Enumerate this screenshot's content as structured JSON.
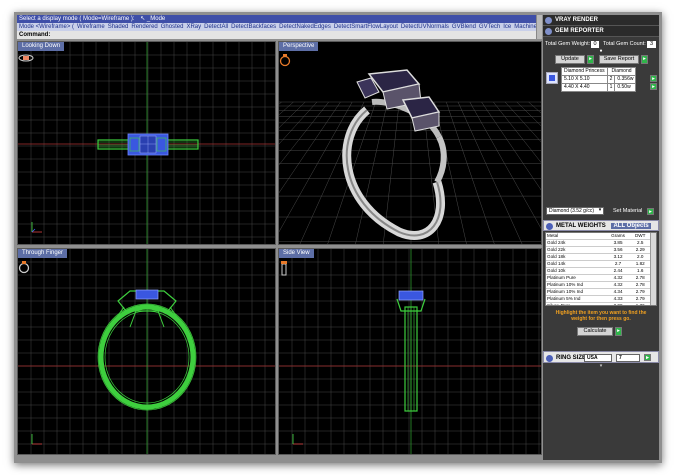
{
  "command_area": {
    "prompt": "Select a display mode ( Mode=Wireframe ):",
    "prompt_tail": "_Mode",
    "modes": [
      "Mode <Wireframe> (",
      "Wireframe",
      "Shaded",
      "Rendered",
      "Ghosted",
      "XRay",
      "DetectAll",
      "DetectBackfaces",
      "DetectNakedEdges",
      "DetectSmartFlowLayout",
      "DetectUVNormals",
      "GVBlend",
      "GVTech",
      "Ice",
      "Machine",
      "Plastic",
      "Presentation"
    ],
    "command_label": "Command:"
  },
  "viewports": {
    "top_left": {
      "title": "Looking Down"
    },
    "top_right": {
      "title": "Perspective"
    },
    "bottom_left": {
      "title": "Through Finger"
    },
    "bottom_right": {
      "title": "Side View"
    }
  },
  "panel": {
    "vray_header": "VRAY RENDER",
    "gem_header": "GEM REPORTER",
    "total_gem_weight_label": "Total Gem Weight:",
    "total_gem_weight_value": "0",
    "total_gem_count_label": "Total Gem Count:",
    "total_gem_count_value": "3",
    "update_label": "Update",
    "save_report_label": "Save Report",
    "gem_table": {
      "headers": [
        "Diamond Princess",
        "Diamond"
      ],
      "rows": [
        {
          "size": "5.10 X 5.10",
          "count": "2",
          "weight": "0.356w"
        },
        {
          "size": "4.40 X 4.40",
          "count": "1",
          "weight": "0.50w"
        }
      ]
    },
    "material_select": "Diamond (3.52 g/cc)",
    "set_material_label": "Set Material",
    "metal_header": "METAL WEIGHTS",
    "metal_header_sub": "ALL Objects",
    "metal_table": {
      "columns": [
        "Metal",
        "Grams",
        "DWT"
      ],
      "rows": [
        [
          "Gold 24k",
          "3.85",
          "2.5"
        ],
        [
          "Gold 22k",
          "3.56",
          "2.29"
        ],
        [
          "Gold 18k",
          "3.12",
          "2.0"
        ],
        [
          "Gold 14k",
          "2.7",
          "1.82"
        ],
        [
          "Gold 10k",
          "2.44",
          "1.6"
        ],
        [
          "Platinum Pure",
          "4.32",
          "2.78"
        ],
        [
          "Platinum 10% Ind",
          "4.32",
          "2.78"
        ],
        [
          "Platinum 10% Ind",
          "4.34",
          "2.79"
        ],
        [
          "Platinum 5% Ind",
          "4.33",
          "2.79"
        ],
        [
          "Silver, Pure",
          "2.09",
          "1.36"
        ],
        [
          "Silver, Sterling (9",
          "2.09",
          "1.36"
        ]
      ]
    },
    "highlight_note": "Highlight the item you want to find the weight for then press go.",
    "calculate_label": "Calculate",
    "ring_header": "RING SIZE",
    "ring_standard": "USA",
    "ring_size": "7"
  },
  "colors": {
    "wire_green": "#3ecf3e",
    "gem_blue": "#3a57e0",
    "grid": "#4a4a4a",
    "title_bar": "#5d6ea6",
    "green_button": "#2fb54a"
  }
}
